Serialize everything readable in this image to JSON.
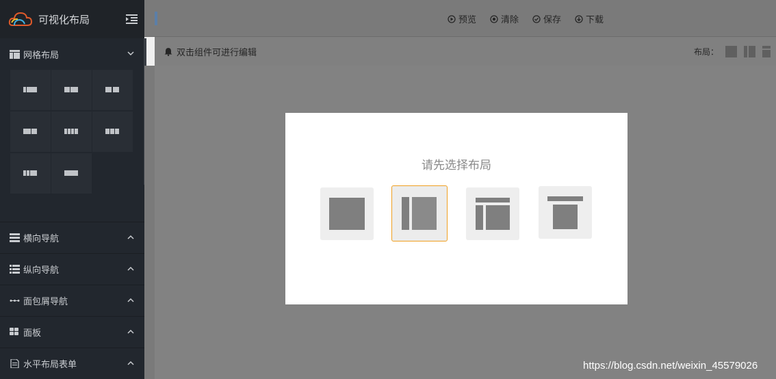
{
  "sidebar": {
    "title": "可视化布局",
    "sections": [
      {
        "label": "网格布局",
        "icon": "grid-layout-icon"
      },
      {
        "label": "横向导航",
        "icon": "horizontal-nav-icon"
      },
      {
        "label": "纵向导航",
        "icon": "vertical-nav-icon"
      },
      {
        "label": "面包屑导航",
        "icon": "breadcrumb-icon"
      },
      {
        "label": "面板",
        "icon": "panel-icon"
      },
      {
        "label": "水平布局表单",
        "icon": "form-icon"
      }
    ]
  },
  "toolbar": {
    "preview": "预览",
    "clear": "清除",
    "save": "保存",
    "download": "下载"
  },
  "subbar": {
    "hint": "双击组件可进行编辑",
    "layout_label": "布局："
  },
  "dialog": {
    "title": "请先选择布局",
    "selected_index": 1
  },
  "watermark": "https://blog.csdn.net/weixin_45579026",
  "colors": {
    "sidebar_bg": "#22272e",
    "selected_border": "#f0a020",
    "overlay": "#808080"
  }
}
